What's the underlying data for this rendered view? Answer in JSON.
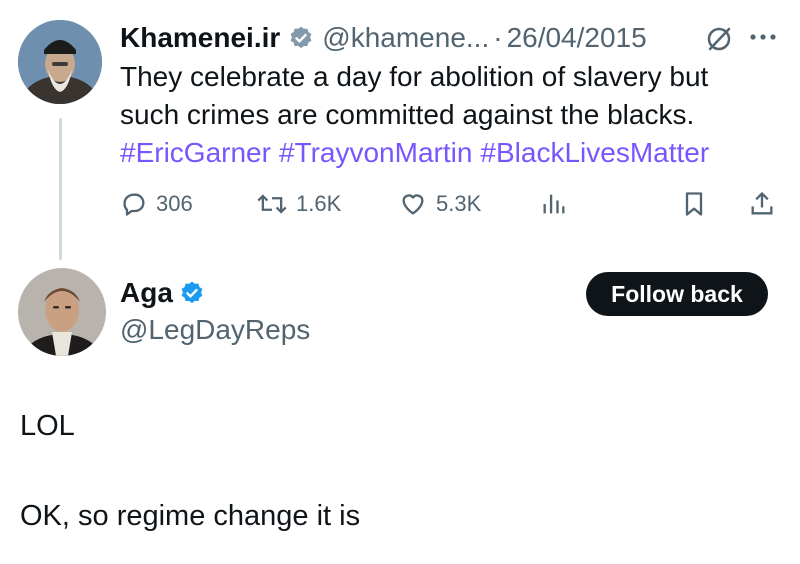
{
  "original_tweet": {
    "display_name": "Khamenei.ir",
    "handle": "@khamene...",
    "separator": "·",
    "date": "26/04/2015",
    "text_line1": "They celebrate a day for abolition of slavery but",
    "text_line2": "such crimes are committed against the blacks.",
    "hashtags": [
      "#EricGarner",
      "#TrayvonMartin",
      "#BlackLivesMatter"
    ],
    "actions": {
      "replies": "306",
      "retweets": "1.6K",
      "likes": "5.3K"
    },
    "verified_badge_color": "#829aab"
  },
  "reply": {
    "display_name": "Aga",
    "handle": "@LegDayReps",
    "follow_label": "Follow back",
    "text_line1": "LOL",
    "text_line2": "OK, so regime change it is",
    "verified_badge_color": "#1d9bf0"
  },
  "colors": {
    "hashtag": "#7856ff",
    "muted": "#536471",
    "thread_line": "#cfd9de"
  },
  "icons": [
    "verified-gray-icon",
    "no-slash-icon",
    "more-icon",
    "reply-icon",
    "retweet-icon",
    "like-icon",
    "views-icon",
    "bookmark-icon",
    "share-icon",
    "verified-blue-icon"
  ]
}
